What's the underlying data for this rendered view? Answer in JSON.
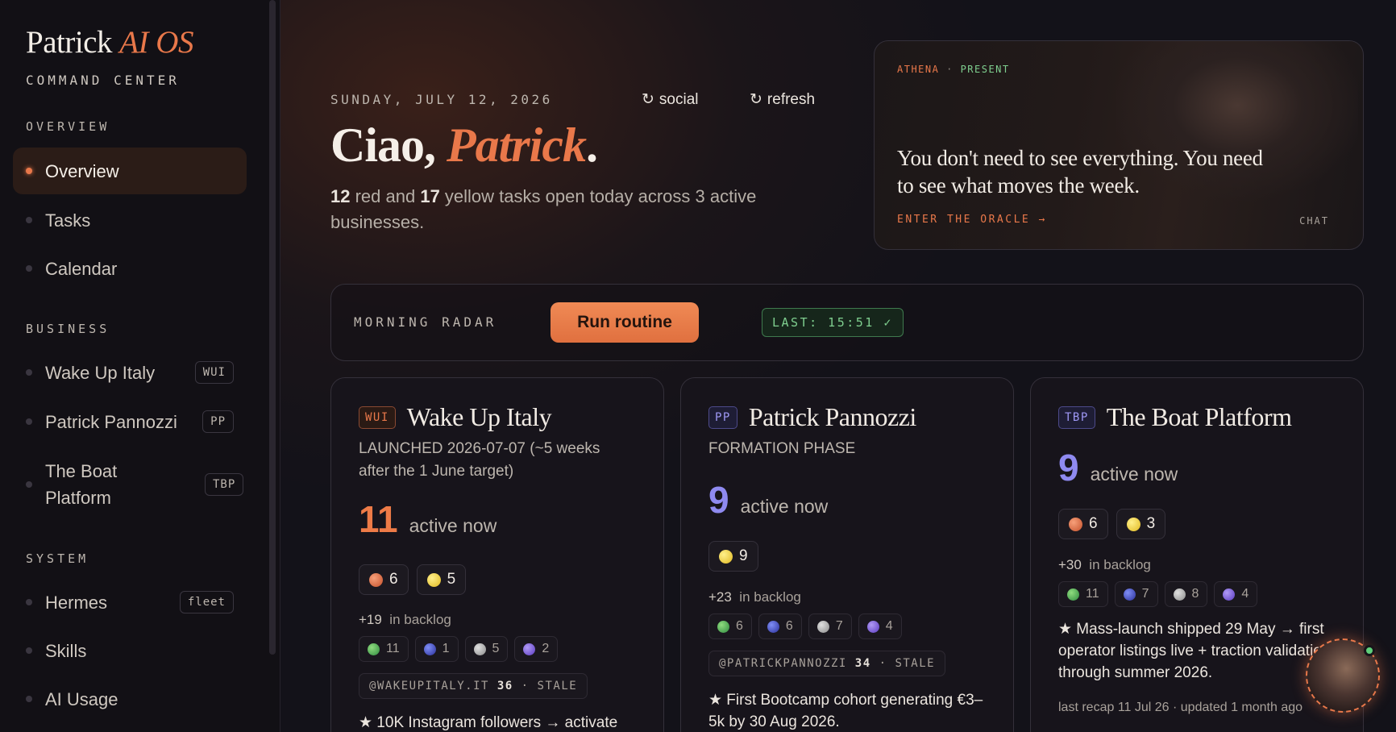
{
  "brand": {
    "name": "Patrick",
    "accent": "AI OS",
    "subtitle": "COMMAND CENTER"
  },
  "sidebar": {
    "overview_label": "OVERVIEW",
    "business_label": "BUSINESS",
    "system_label": "SYSTEM",
    "overview_items": [
      {
        "label": "Overview"
      },
      {
        "label": "Tasks"
      },
      {
        "label": "Calendar"
      }
    ],
    "business_items": [
      {
        "label": "Wake Up Italy",
        "badge": "WUI"
      },
      {
        "label": "Patrick Pannozzi",
        "badge": "PP"
      },
      {
        "label": "The Boat Platform",
        "badge": "TBP"
      }
    ],
    "system_items": [
      {
        "label": "Hermes",
        "badge": "fleet"
      },
      {
        "label": "Skills"
      },
      {
        "label": "AI Usage"
      }
    ]
  },
  "header": {
    "date": "SUNDAY, JULY 12, 2026",
    "social_label": "social",
    "refresh_label": "refresh",
    "greeting_prefix": "Ciao, ",
    "greeting_name": "Patrick",
    "greeting_suffix": ".",
    "summary": {
      "red": "12",
      "text1": " red and ",
      "yellow": "17",
      "text2": " yellow tasks open today across 3 active businesses."
    }
  },
  "oracle": {
    "agent": "ATHENA",
    "sep": "·",
    "status": "PRESENT",
    "quote": "You don't need to see everything. You need to see what moves the week.",
    "link": "ENTER THE ORACLE →",
    "chat": "CHAT"
  },
  "radar": {
    "label": "MORNING RADAR",
    "button": "Run routine",
    "last": "LAST: 15:51 ✓"
  },
  "businesses": [
    {
      "code": "WUI",
      "name": "Wake Up Italy",
      "subtitle": "LAUNCHED 2026-07-07 (~5 weeks after the 1 June target)",
      "active_count": "11",
      "active_label": "active now",
      "red": "6",
      "yellow": "5",
      "backlog_count": "+19",
      "backlog_label": "in backlog",
      "green": "11",
      "blue": "1",
      "gray": "5",
      "violet": "2",
      "handle": "@WAKEUPITALY.IT",
      "handle_count": "36",
      "handle_status": "· STALE",
      "goal": "★ 10K Instagram followers → activate"
    },
    {
      "code": "PP",
      "name": "Patrick Pannozzi",
      "subtitle": "FORMATION PHASE",
      "active_count": "9",
      "active_label": "active now",
      "yellow": "9",
      "backlog_count": "+23",
      "backlog_label": "in backlog",
      "green": "6",
      "blue": "6",
      "gray": "7",
      "violet": "4",
      "handle": "@PATRICKPANNOZZI",
      "handle_count": "34",
      "handle_status": "· STALE",
      "goal": "★ First Bootcamp cohort generating €3–5k by 30 Aug 2026."
    },
    {
      "code": "TBP",
      "name": "The Boat Platform",
      "active_count": "9",
      "active_label": "active now",
      "red": "6",
      "yellow": "3",
      "backlog_count": "+30",
      "backlog_label": "in backlog",
      "green": "11",
      "blue": "7",
      "gray": "8",
      "violet": "4",
      "goal": "★ Mass-launch shipped 29 May → first operator listings live + traction validation through summer 2026.",
      "recap": "last recap 11 Jul 26 · updated 1 month ago"
    }
  ],
  "colors": {
    "accent": "#e9784a",
    "purple": "#8f8af0",
    "green": "#7fcf8f"
  }
}
